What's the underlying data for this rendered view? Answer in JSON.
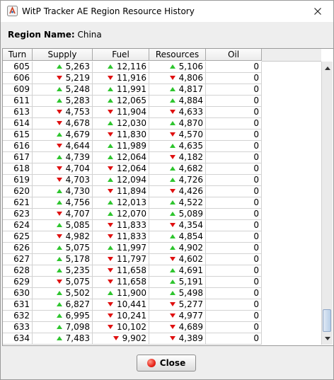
{
  "window": {
    "title": "WitP Tracker AE Region Resource History",
    "close_icon": "close-icon",
    "app_icon": "app-icon"
  },
  "region": {
    "label": "Region Name:",
    "value": "China"
  },
  "table": {
    "headers": [
      "Turn",
      "Supply",
      "Fuel",
      "Resources",
      "Oil"
    ],
    "rows": [
      {
        "turn": "605",
        "supply": "5,263",
        "supply_trend": "up",
        "fuel": "12,116",
        "fuel_trend": "up",
        "resources": "5,106",
        "resources_trend": "up",
        "oil": "0"
      },
      {
        "turn": "606",
        "supply": "5,219",
        "supply_trend": "down",
        "fuel": "11,916",
        "fuel_trend": "down",
        "resources": "4,806",
        "resources_trend": "down",
        "oil": "0"
      },
      {
        "turn": "609",
        "supply": "5,248",
        "supply_trend": "up",
        "fuel": "11,991",
        "fuel_trend": "up",
        "resources": "4,817",
        "resources_trend": "up",
        "oil": "0"
      },
      {
        "turn": "611",
        "supply": "5,283",
        "supply_trend": "up",
        "fuel": "12,065",
        "fuel_trend": "up",
        "resources": "4,884",
        "resources_trend": "up",
        "oil": "0"
      },
      {
        "turn": "613",
        "supply": "4,753",
        "supply_trend": "down",
        "fuel": "11,904",
        "fuel_trend": "down",
        "resources": "4,633",
        "resources_trend": "down",
        "oil": "0"
      },
      {
        "turn": "614",
        "supply": "4,678",
        "supply_trend": "down",
        "fuel": "12,030",
        "fuel_trend": "up",
        "resources": "4,870",
        "resources_trend": "up",
        "oil": "0"
      },
      {
        "turn": "615",
        "supply": "4,679",
        "supply_trend": "up",
        "fuel": "11,830",
        "fuel_trend": "down",
        "resources": "4,570",
        "resources_trend": "down",
        "oil": "0"
      },
      {
        "turn": "616",
        "supply": "4,644",
        "supply_trend": "down",
        "fuel": "11,989",
        "fuel_trend": "up",
        "resources": "4,635",
        "resources_trend": "up",
        "oil": "0"
      },
      {
        "turn": "617",
        "supply": "4,739",
        "supply_trend": "up",
        "fuel": "12,064",
        "fuel_trend": "up",
        "resources": "4,182",
        "resources_trend": "down",
        "oil": "0"
      },
      {
        "turn": "618",
        "supply": "4,704",
        "supply_trend": "down",
        "fuel": "12,064",
        "fuel_trend": "down",
        "resources": "4,682",
        "resources_trend": "up",
        "oil": "0"
      },
      {
        "turn": "619",
        "supply": "4,703",
        "supply_trend": "down",
        "fuel": "12,094",
        "fuel_trend": "up",
        "resources": "4,726",
        "resources_trend": "up",
        "oil": "0"
      },
      {
        "turn": "620",
        "supply": "4,730",
        "supply_trend": "up",
        "fuel": "11,894",
        "fuel_trend": "down",
        "resources": "4,426",
        "resources_trend": "down",
        "oil": "0"
      },
      {
        "turn": "621",
        "supply": "4,756",
        "supply_trend": "up",
        "fuel": "12,013",
        "fuel_trend": "up",
        "resources": "4,522",
        "resources_trend": "up",
        "oil": "0"
      },
      {
        "turn": "623",
        "supply": "4,707",
        "supply_trend": "down",
        "fuel": "12,070",
        "fuel_trend": "up",
        "resources": "5,089",
        "resources_trend": "up",
        "oil": "0"
      },
      {
        "turn": "624",
        "supply": "5,085",
        "supply_trend": "up",
        "fuel": "11,833",
        "fuel_trend": "down",
        "resources": "4,354",
        "resources_trend": "down",
        "oil": "0"
      },
      {
        "turn": "625",
        "supply": "4,982",
        "supply_trend": "down",
        "fuel": "11,833",
        "fuel_trend": "down",
        "resources": "4,854",
        "resources_trend": "up",
        "oil": "0"
      },
      {
        "turn": "626",
        "supply": "5,075",
        "supply_trend": "up",
        "fuel": "11,997",
        "fuel_trend": "up",
        "resources": "4,902",
        "resources_trend": "up",
        "oil": "0"
      },
      {
        "turn": "627",
        "supply": "5,178",
        "supply_trend": "up",
        "fuel": "11,797",
        "fuel_trend": "down",
        "resources": "4,602",
        "resources_trend": "down",
        "oil": "0"
      },
      {
        "turn": "628",
        "supply": "5,235",
        "supply_trend": "up",
        "fuel": "11,658",
        "fuel_trend": "down",
        "resources": "4,691",
        "resources_trend": "up",
        "oil": "0"
      },
      {
        "turn": "629",
        "supply": "5,075",
        "supply_trend": "down",
        "fuel": "11,658",
        "fuel_trend": "down",
        "resources": "5,191",
        "resources_trend": "up",
        "oil": "0"
      },
      {
        "turn": "630",
        "supply": "5,502",
        "supply_trend": "up",
        "fuel": "11,900",
        "fuel_trend": "up",
        "resources": "5,498",
        "resources_trend": "up",
        "oil": "0"
      },
      {
        "turn": "631",
        "supply": "6,827",
        "supply_trend": "up",
        "fuel": "10,441",
        "fuel_trend": "down",
        "resources": "5,277",
        "resources_trend": "down",
        "oil": "0"
      },
      {
        "turn": "632",
        "supply": "6,995",
        "supply_trend": "up",
        "fuel": "10,241",
        "fuel_trend": "down",
        "resources": "4,977",
        "resources_trend": "down",
        "oil": "0"
      },
      {
        "turn": "633",
        "supply": "7,098",
        "supply_trend": "up",
        "fuel": "10,102",
        "fuel_trend": "down",
        "resources": "4,689",
        "resources_trend": "down",
        "oil": "0"
      },
      {
        "turn": "634",
        "supply": "7,483",
        "supply_trend": "up",
        "fuel": "9,902",
        "fuel_trend": "down",
        "resources": "4,389",
        "resources_trend": "down",
        "oil": "0"
      }
    ]
  },
  "colors": {
    "trend_up": "#2ec52e",
    "trend_down": "#e01010"
  },
  "footer": {
    "close_label": "Close"
  }
}
